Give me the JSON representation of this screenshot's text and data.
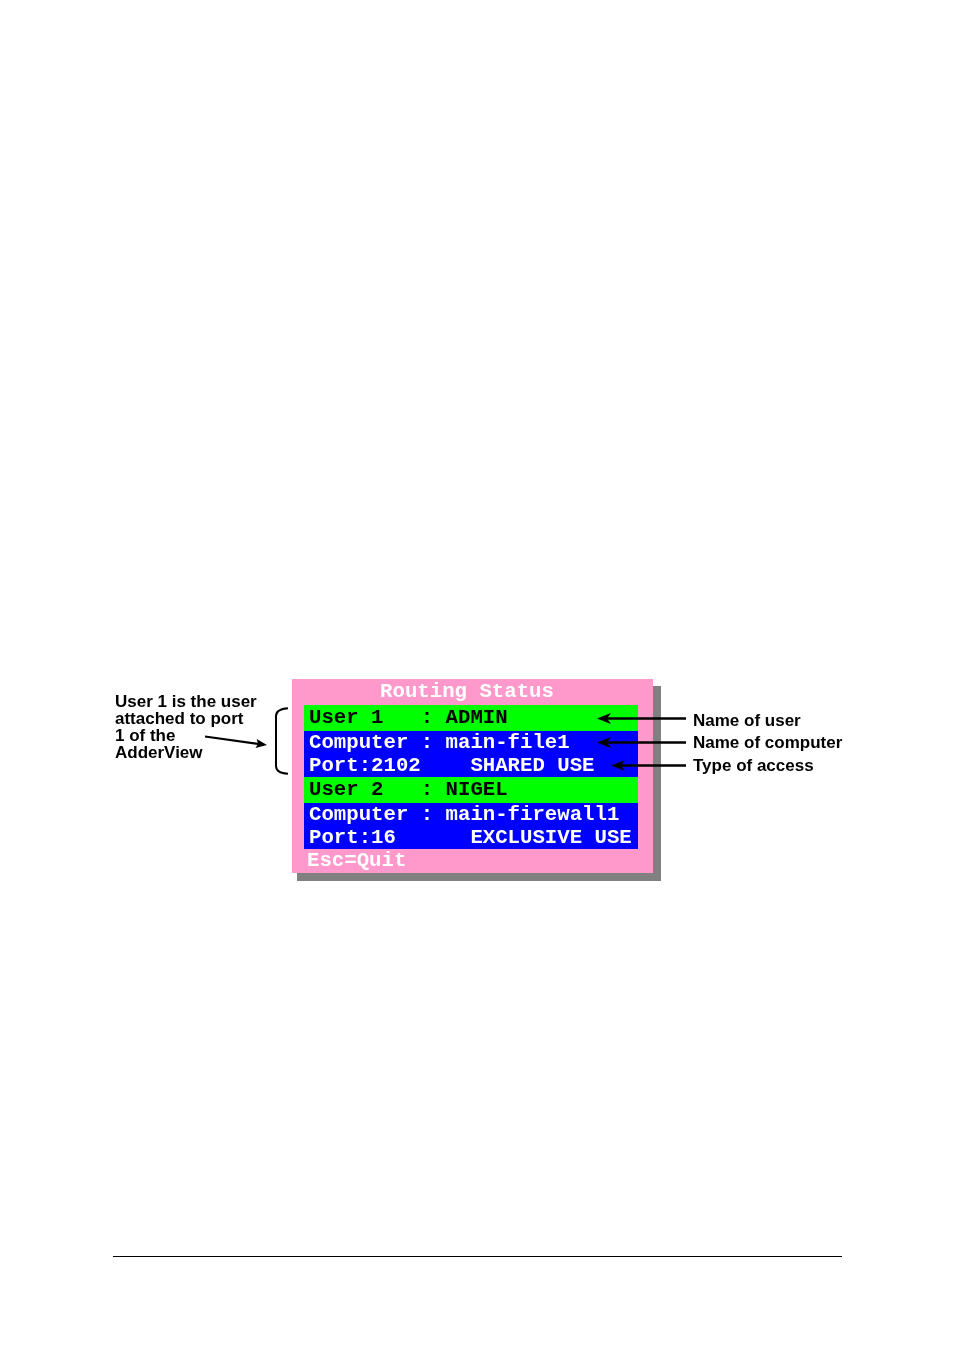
{
  "dialog": {
    "title": "Routing Status",
    "routes": [
      {
        "user_label": "User 1",
        "user_separator": ":",
        "user_name": "ADMIN",
        "computer_label": "Computer",
        "computer_separator": ":",
        "computer_name": "main-file1",
        "port": "Port:2102",
        "access": "SHARED USE"
      },
      {
        "user_label": "User 2",
        "user_separator": ":",
        "user_name": "NIGEL",
        "computer_label": "Computer",
        "computer_separator": ":",
        "computer_name": "main-firewall1",
        "port": "Port:16",
        "access": "EXCLUSIVE USE"
      }
    ],
    "footer": "Esc=Quit"
  },
  "note": {
    "lines": [
      "User 1 is the user",
      "attached to port",
      "1 of the",
      "AdderView"
    ]
  },
  "callouts": [
    {
      "text": "Name of user"
    },
    {
      "text": "Name of computer"
    },
    {
      "text": "Type of access"
    }
  ]
}
